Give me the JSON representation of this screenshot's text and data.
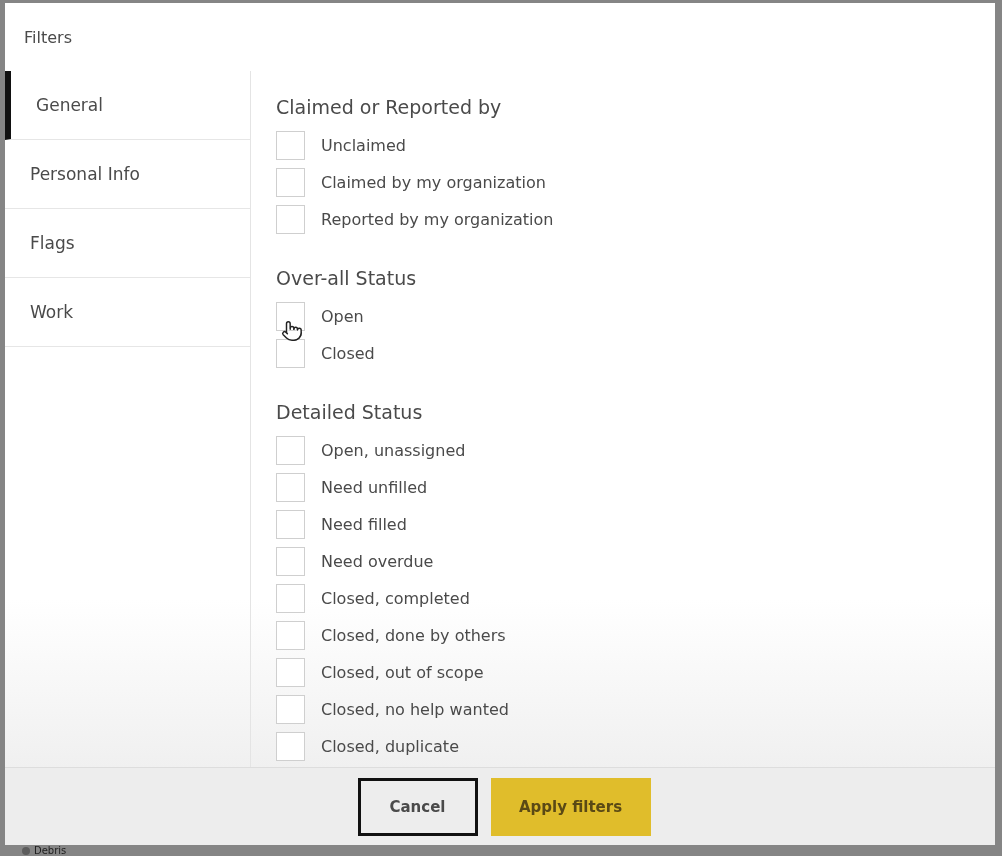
{
  "dialog": {
    "title": "Filters"
  },
  "tabs": [
    {
      "label": "General",
      "selected": true
    },
    {
      "label": "Personal Info",
      "selected": false
    },
    {
      "label": "Flags",
      "selected": false
    },
    {
      "label": "Work",
      "selected": false
    }
  ],
  "sections": [
    {
      "heading": "Claimed or Reported by",
      "options": [
        {
          "label": "Unclaimed",
          "checked": false
        },
        {
          "label": "Claimed by my organization",
          "checked": false
        },
        {
          "label": "Reported by my organization",
          "checked": false
        }
      ]
    },
    {
      "heading": "Over-all Status",
      "options": [
        {
          "label": "Open",
          "checked": false
        },
        {
          "label": "Closed",
          "checked": false
        }
      ]
    },
    {
      "heading": "Detailed Status",
      "options": [
        {
          "label": "Open, unassigned",
          "checked": false
        },
        {
          "label": "Need unfilled",
          "checked": false
        },
        {
          "label": "Need filled",
          "checked": false
        },
        {
          "label": "Need overdue",
          "checked": false
        },
        {
          "label": "Closed, completed",
          "checked": false
        },
        {
          "label": "Closed, done by others",
          "checked": false
        },
        {
          "label": "Closed, out of scope",
          "checked": false
        },
        {
          "label": "Closed, no help wanted",
          "checked": false
        },
        {
          "label": "Closed, duplicate",
          "checked": false
        }
      ]
    }
  ],
  "buttons": [
    {
      "label": "Cancel",
      "kind": "secondary"
    },
    {
      "label": "Apply filters",
      "kind": "primary"
    }
  ],
  "background": {
    "items": [
      {
        "label": "Debris"
      }
    ]
  }
}
